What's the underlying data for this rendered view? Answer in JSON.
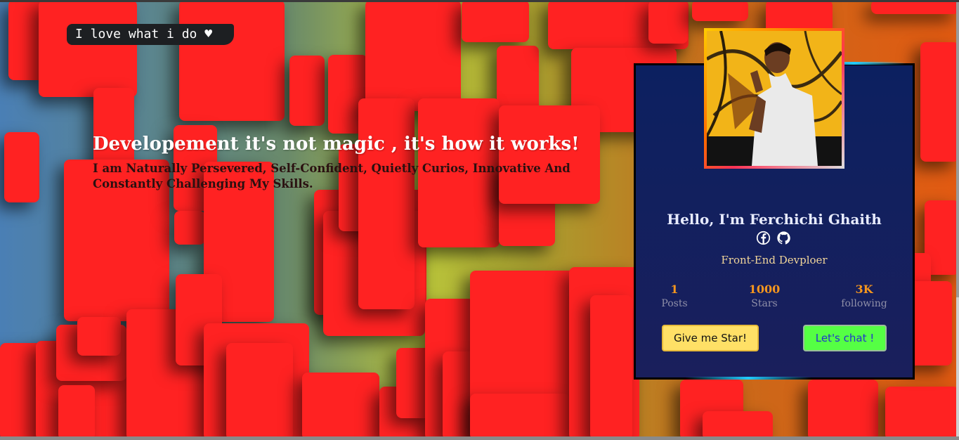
{
  "hero": {
    "tagline": "I love what i do ♥",
    "headline": "Developement it's not magic , it's how it works!",
    "subline": "I am Naturally Persevered, Self-Confident, Quietly Curios, Innovative And Constantly Challenging My Skills."
  },
  "profile": {
    "name": "Hello, I'm Ferchichi Ghaith",
    "role": "Front-End Devploer",
    "socials": [
      "facebook-icon",
      "github-icon"
    ],
    "stats": [
      {
        "value": "1",
        "label": "Posts"
      },
      {
        "value": "1000",
        "label": "Stars"
      },
      {
        "value": "3K",
        "label": "following"
      }
    ],
    "star_button": "Give me Star!",
    "chat_button": "Let's chat !"
  },
  "colors": {
    "tile": "#ff2222",
    "card_bg": "#0c2060",
    "stat_value": "#f5961e",
    "star_button": "#ffe066",
    "chat_button": "#55ff44"
  }
}
